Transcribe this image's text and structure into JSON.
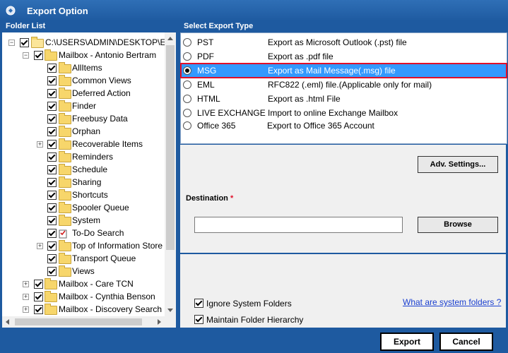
{
  "window": {
    "title": "Export Option"
  },
  "folder_list": {
    "heading": "Folder List",
    "nodes": [
      {
        "label": "C:\\USERS\\ADMIN\\DESKTOP\\ED"
      },
      {
        "label": "Mailbox - Antonio Bertram"
      },
      {
        "label": "AllItems"
      },
      {
        "label": "Common Views"
      },
      {
        "label": "Deferred Action"
      },
      {
        "label": "Finder"
      },
      {
        "label": "Freebusy Data"
      },
      {
        "label": "Orphan"
      },
      {
        "label": "Recoverable Items"
      },
      {
        "label": "Reminders"
      },
      {
        "label": "Schedule"
      },
      {
        "label": "Sharing"
      },
      {
        "label": "Shortcuts"
      },
      {
        "label": "Spooler Queue"
      },
      {
        "label": "System"
      },
      {
        "label": "To-Do Search"
      },
      {
        "label": "Top of Information Store"
      },
      {
        "label": "Transport Queue"
      },
      {
        "label": "Views"
      },
      {
        "label": "Mailbox - Care TCN"
      },
      {
        "label": "Mailbox - Cynthia Benson"
      },
      {
        "label": "Mailbox - Discovery Search M"
      }
    ]
  },
  "export_type": {
    "heading": "Select Export Type",
    "options": [
      {
        "name": "PST",
        "desc": "Export as Microsoft Outlook (.pst) file"
      },
      {
        "name": "PDF",
        "desc": "Export as .pdf file"
      },
      {
        "name": "MSG",
        "desc": "Export as Mail Message(.msg) file"
      },
      {
        "name": "EML",
        "desc": "RFC822 (.eml) file.(Applicable only for mail)"
      },
      {
        "name": "HTML",
        "desc": "Export as .html File"
      },
      {
        "name": "LIVE EXCHANGE",
        "desc": "Import to online Exchange Mailbox"
      },
      {
        "name": "Office 365",
        "desc": "Export to Office 365 Account"
      }
    ],
    "selected": "MSG"
  },
  "settings": {
    "adv_settings_label": "Adv. Settings...",
    "destination_label": "Destination",
    "destination_required_mark": "*",
    "destination_value": "",
    "browse_label": "Browse"
  },
  "options": {
    "ignore_system_folders": "Ignore System Folders",
    "maintain_hierarchy": "Maintain Folder Hierarchy",
    "system_folders_link": "What are system folders ?"
  },
  "footer": {
    "export_label": "Export",
    "cancel_label": "Cancel"
  },
  "colors": {
    "title_bg": "#1e5aa0",
    "selection": "#3399ff",
    "highlight_border": "#e0102a",
    "link": "#1a3fd0"
  }
}
